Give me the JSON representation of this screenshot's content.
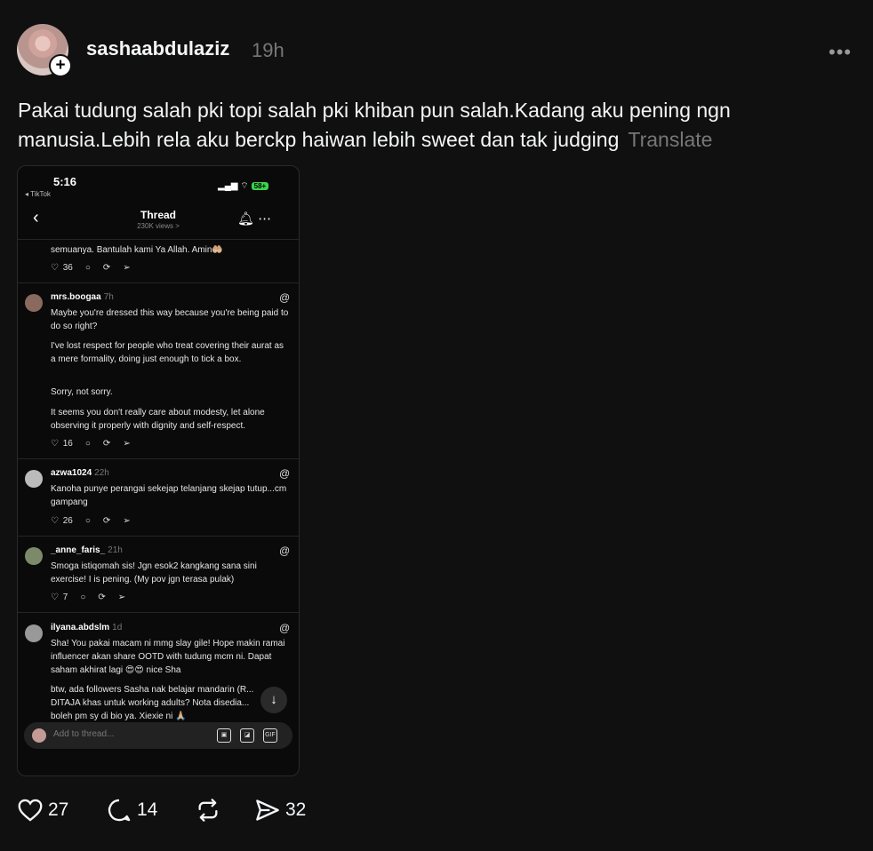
{
  "post": {
    "username": "sashaabdulaziz",
    "time": "19h",
    "more_label": "•••",
    "text": "Pakai tudung salah pki topi salah pki khiban pun salah.Kadang aku pening ngn manusia.Lebih rela aku berckp haiwan lebih sweet dan tak judging",
    "translate": "Translate"
  },
  "screenshot": {
    "status_time": "5:16",
    "status_app": "◂ TikTok",
    "battery": "58+",
    "nav_title": "Thread",
    "nav_views": "230K views >",
    "top_snippet": "semuanya. Bantulah kami Ya Allah. Amin🤲🏼",
    "top_likes": "36",
    "comments": [
      {
        "user": "mrs.boogaa",
        "ago": "7h",
        "paragraphs": [
          "Maybe you're dressed this way because you're being paid to do so right?",
          "I've lost respect for people who treat covering their aurat as a mere formality, doing just enough to tick a box.",
          "Sorry, not sorry.",
          "It seems you don't really care about modesty, let alone observing it properly with dignity and self-respect."
        ],
        "likes": "16"
      },
      {
        "user": "azwa1024",
        "ago": "22h",
        "paragraphs": [
          "Kanoha punye perangai sekejap telanjang skejap tutup...cm gampang"
        ],
        "likes": "26"
      },
      {
        "user": "_anne_faris_",
        "ago": "21h",
        "paragraphs": [
          "Smoga istiqomah sis! Jgn esok2 kangkang sana sini exercise! I is pening. (My pov jgn terasa pulak)"
        ],
        "likes": "7"
      },
      {
        "user": "ilyana.abdslm",
        "ago": "1d",
        "paragraphs": [
          "Sha! You pakai macam ni mmg slay gile! Hope makin ramai influencer akan share OOTD with tudung mcm ni. Dapat saham akhirat lagi 😍😍 nice Sha",
          "btw, ada followers Sasha nak belajar mandarin (R... DITAJA khas untuk working adults? Nota disedia... boleh pm sy di bio ya. Xiexie ni 🙏🏼"
        ]
      }
    ],
    "add_placeholder": "Add to thread...",
    "gif_label": "GIF"
  },
  "actions": {
    "likes": "27",
    "replies": "14",
    "shares": "32"
  }
}
